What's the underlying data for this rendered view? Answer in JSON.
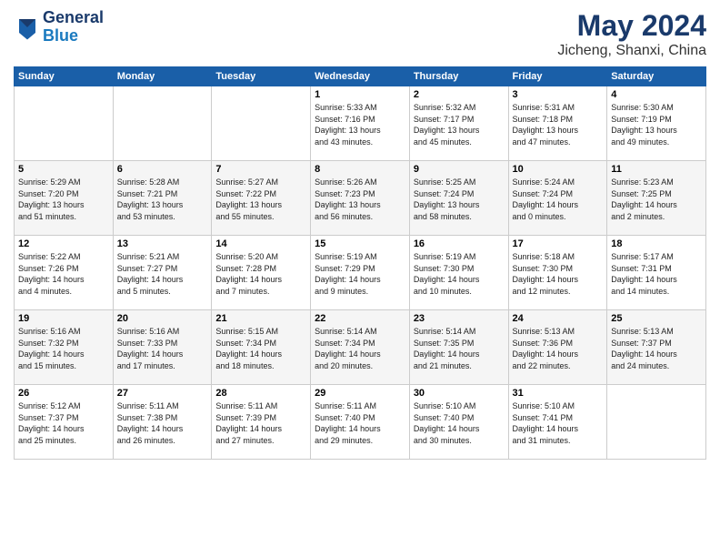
{
  "logo": {
    "line1": "General",
    "line2": "Blue"
  },
  "title": "May 2024",
  "location": "Jicheng, Shanxi, China",
  "days_header": [
    "Sunday",
    "Monday",
    "Tuesday",
    "Wednesday",
    "Thursday",
    "Friday",
    "Saturday"
  ],
  "weeks": [
    [
      {
        "day": "",
        "info": ""
      },
      {
        "day": "",
        "info": ""
      },
      {
        "day": "",
        "info": ""
      },
      {
        "day": "1",
        "info": "Sunrise: 5:33 AM\nSunset: 7:16 PM\nDaylight: 13 hours\nand 43 minutes."
      },
      {
        "day": "2",
        "info": "Sunrise: 5:32 AM\nSunset: 7:17 PM\nDaylight: 13 hours\nand 45 minutes."
      },
      {
        "day": "3",
        "info": "Sunrise: 5:31 AM\nSunset: 7:18 PM\nDaylight: 13 hours\nand 47 minutes."
      },
      {
        "day": "4",
        "info": "Sunrise: 5:30 AM\nSunset: 7:19 PM\nDaylight: 13 hours\nand 49 minutes."
      }
    ],
    [
      {
        "day": "5",
        "info": "Sunrise: 5:29 AM\nSunset: 7:20 PM\nDaylight: 13 hours\nand 51 minutes."
      },
      {
        "day": "6",
        "info": "Sunrise: 5:28 AM\nSunset: 7:21 PM\nDaylight: 13 hours\nand 53 minutes."
      },
      {
        "day": "7",
        "info": "Sunrise: 5:27 AM\nSunset: 7:22 PM\nDaylight: 13 hours\nand 55 minutes."
      },
      {
        "day": "8",
        "info": "Sunrise: 5:26 AM\nSunset: 7:23 PM\nDaylight: 13 hours\nand 56 minutes."
      },
      {
        "day": "9",
        "info": "Sunrise: 5:25 AM\nSunset: 7:24 PM\nDaylight: 13 hours\nand 58 minutes."
      },
      {
        "day": "10",
        "info": "Sunrise: 5:24 AM\nSunset: 7:24 PM\nDaylight: 14 hours\nand 0 minutes."
      },
      {
        "day": "11",
        "info": "Sunrise: 5:23 AM\nSunset: 7:25 PM\nDaylight: 14 hours\nand 2 minutes."
      }
    ],
    [
      {
        "day": "12",
        "info": "Sunrise: 5:22 AM\nSunset: 7:26 PM\nDaylight: 14 hours\nand 4 minutes."
      },
      {
        "day": "13",
        "info": "Sunrise: 5:21 AM\nSunset: 7:27 PM\nDaylight: 14 hours\nand 5 minutes."
      },
      {
        "day": "14",
        "info": "Sunrise: 5:20 AM\nSunset: 7:28 PM\nDaylight: 14 hours\nand 7 minutes."
      },
      {
        "day": "15",
        "info": "Sunrise: 5:19 AM\nSunset: 7:29 PM\nDaylight: 14 hours\nand 9 minutes."
      },
      {
        "day": "16",
        "info": "Sunrise: 5:19 AM\nSunset: 7:30 PM\nDaylight: 14 hours\nand 10 minutes."
      },
      {
        "day": "17",
        "info": "Sunrise: 5:18 AM\nSunset: 7:30 PM\nDaylight: 14 hours\nand 12 minutes."
      },
      {
        "day": "18",
        "info": "Sunrise: 5:17 AM\nSunset: 7:31 PM\nDaylight: 14 hours\nand 14 minutes."
      }
    ],
    [
      {
        "day": "19",
        "info": "Sunrise: 5:16 AM\nSunset: 7:32 PM\nDaylight: 14 hours\nand 15 minutes."
      },
      {
        "day": "20",
        "info": "Sunrise: 5:16 AM\nSunset: 7:33 PM\nDaylight: 14 hours\nand 17 minutes."
      },
      {
        "day": "21",
        "info": "Sunrise: 5:15 AM\nSunset: 7:34 PM\nDaylight: 14 hours\nand 18 minutes."
      },
      {
        "day": "22",
        "info": "Sunrise: 5:14 AM\nSunset: 7:34 PM\nDaylight: 14 hours\nand 20 minutes."
      },
      {
        "day": "23",
        "info": "Sunrise: 5:14 AM\nSunset: 7:35 PM\nDaylight: 14 hours\nand 21 minutes."
      },
      {
        "day": "24",
        "info": "Sunrise: 5:13 AM\nSunset: 7:36 PM\nDaylight: 14 hours\nand 22 minutes."
      },
      {
        "day": "25",
        "info": "Sunrise: 5:13 AM\nSunset: 7:37 PM\nDaylight: 14 hours\nand 24 minutes."
      }
    ],
    [
      {
        "day": "26",
        "info": "Sunrise: 5:12 AM\nSunset: 7:37 PM\nDaylight: 14 hours\nand 25 minutes."
      },
      {
        "day": "27",
        "info": "Sunrise: 5:11 AM\nSunset: 7:38 PM\nDaylight: 14 hours\nand 26 minutes."
      },
      {
        "day": "28",
        "info": "Sunrise: 5:11 AM\nSunset: 7:39 PM\nDaylight: 14 hours\nand 27 minutes."
      },
      {
        "day": "29",
        "info": "Sunrise: 5:11 AM\nSunset: 7:40 PM\nDaylight: 14 hours\nand 29 minutes."
      },
      {
        "day": "30",
        "info": "Sunrise: 5:10 AM\nSunset: 7:40 PM\nDaylight: 14 hours\nand 30 minutes."
      },
      {
        "day": "31",
        "info": "Sunrise: 5:10 AM\nSunset: 7:41 PM\nDaylight: 14 hours\nand 31 minutes."
      },
      {
        "day": "",
        "info": ""
      }
    ]
  ]
}
